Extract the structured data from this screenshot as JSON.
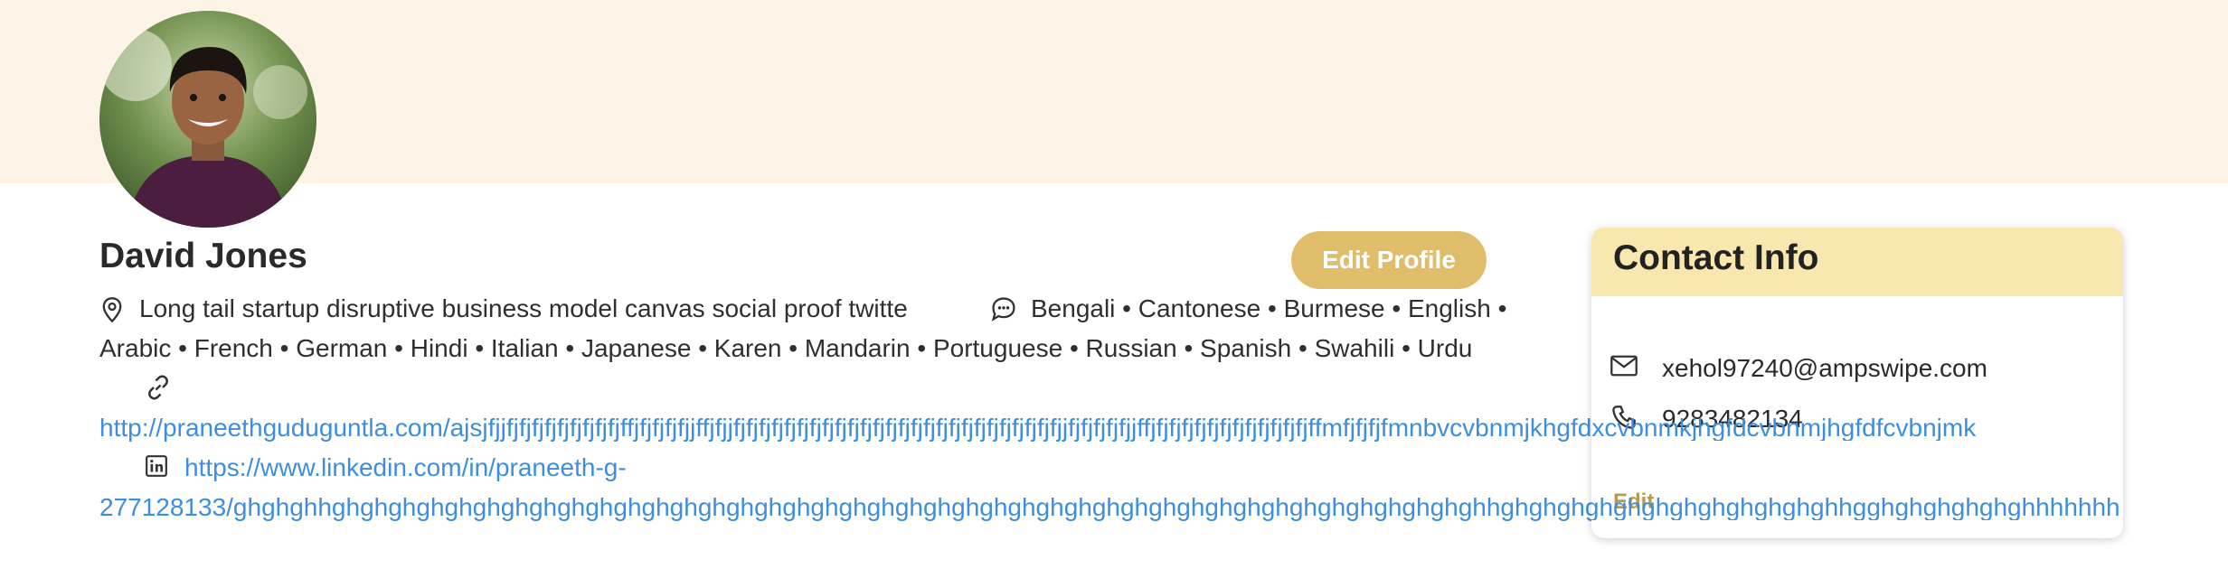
{
  "profile": {
    "name": "David Jones",
    "edit_button": "Edit Profile",
    "location": "Long tail startup disruptive business model canvas social proof twitte",
    "languages_line1": "Bengali • Cantonese • Burmese • English •",
    "languages_line2": "Arabic • French • German • Hindi • Italian • Japanese • Karen • Mandarin • Portuguese • Russian • Spanish • Swahili • Urdu",
    "website": "http://praneethguduguntla.com/ajsjfjjfjfjfjfjfjfjfjfjfjffjfjfjfjfjjffjfjjfjfjfjfjfjfjfjfjfjfjfjfjfjfjfjfjfjfjfjfjfjfjfjfjfjfjjfjfjfjfjfjjffjfjfjfjfjfjfjfjfjfjfjfjfjffmfjfjfjfmnbvcvbnmjkhgfdxcvbnmkjhgfdcvbnmjhgfdfcvbnjmk",
    "linkedin_line1": "https://www.linkedin.com/in/praneeth-g-",
    "linkedin_line2": "277128133/ghghghhghghghghghghghghghghghghghghghghghghghghghghghghghghghghghghghghghghghghghghghghghhghghghghghghghghghghghghhgghghghghghghhhhhhh"
  },
  "contact": {
    "title": "Contact Info",
    "email": "xehol97240@ampswipe.com",
    "phone": "9283482134",
    "edit": "Edit"
  },
  "colors": {
    "banner": "#fdf4e7",
    "accent": "#dfbd6a",
    "card_header": "#f9e7b0",
    "link": "#3d8ee0"
  },
  "icons": [
    "location-icon",
    "chat-icon",
    "link-icon",
    "linkedin-icon",
    "mail-icon",
    "phone-icon"
  ]
}
